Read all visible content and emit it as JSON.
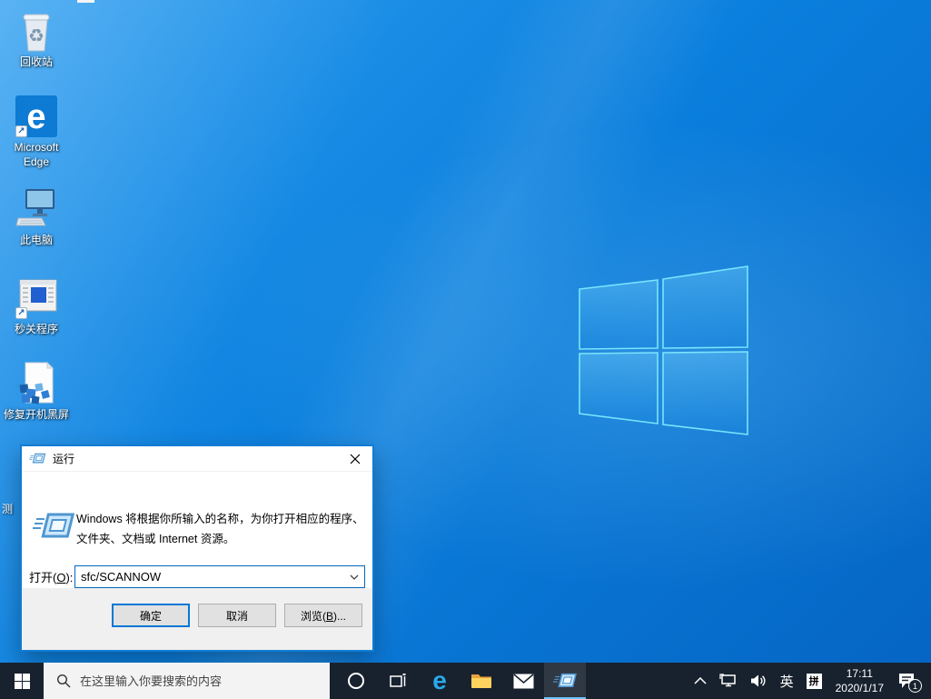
{
  "desktop": {
    "icons": [
      {
        "label": "回收站"
      },
      {
        "label": "Microsoft Edge"
      },
      {
        "label": "此电脑"
      },
      {
        "label": "秒关程序"
      },
      {
        "label": "修复开机黑屏"
      }
    ],
    "partial_icon_label": "测"
  },
  "run_dialog": {
    "title": "运行",
    "message_line1": "Windows 将根据你所输入的名称，为你打开相应的程序、",
    "message_line2": "文件夹、文档或 Internet 资源。",
    "open_label": {
      "prefix": "打开(",
      "mnemonic": "O",
      "suffix": "):"
    },
    "input_value": "sfc/SCANNOW",
    "buttons": {
      "ok": "确定",
      "cancel": "取消",
      "browse": {
        "prefix": "浏览(",
        "mnemonic": "B",
        "suffix": ")..."
      }
    }
  },
  "taskbar": {
    "search_placeholder": "在这里输入你要搜索的内容",
    "tray": {
      "ime_mode": "英",
      "ime_badge": "拼",
      "time": "17:11",
      "date": "2020/1/17",
      "notification_count": "1"
    }
  },
  "colors": {
    "accent": "#0078d7",
    "taskbar_bg": "#18222e",
    "wallpaper_base": "#0b7fdd",
    "dialog_footer": "#f0f0f0",
    "active_task_underline": "#6fc3f7"
  }
}
